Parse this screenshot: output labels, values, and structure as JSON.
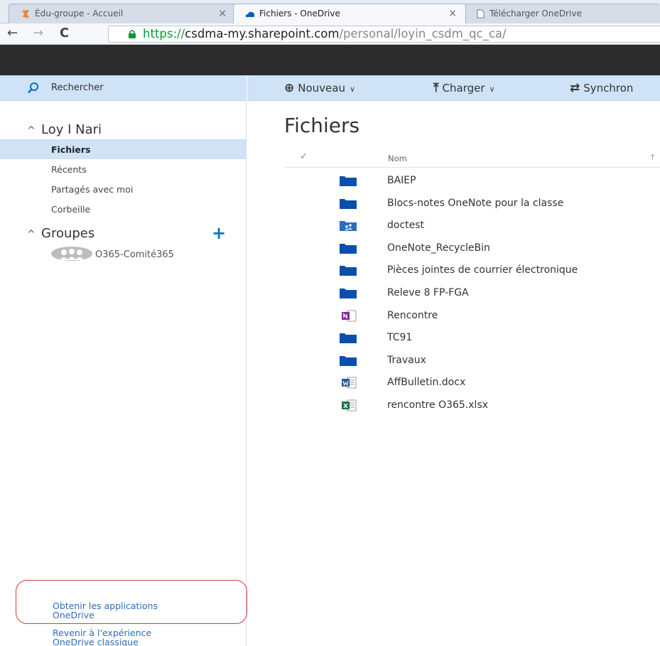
{
  "browser": {
    "tabs": [
      {
        "label": "Édu-groupe - Accueil",
        "close": "×"
      },
      {
        "label": "Fichiers - OneDrive",
        "close": "×"
      },
      {
        "label": "Télécharger OneDrive"
      }
    ],
    "url": {
      "scheme": "https://",
      "host": "csdma-my.sharepoint.com",
      "path": "/personal/loyin_csdm_qc_ca/"
    }
  },
  "leftnav": {
    "search_label": "Rechercher",
    "user_name": "Loy I Nari",
    "items": [
      {
        "label": "Fichiers"
      },
      {
        "label": "Récents"
      },
      {
        "label": "Partagés avec moi"
      },
      {
        "label": "Corbeille"
      }
    ],
    "groups_title": "Groupes",
    "groups_add": "+",
    "groups": [
      {
        "label": "O365-Comité365"
      }
    ],
    "get_apps_link": [
      "Obtenir les applications",
      "OneDrive"
    ],
    "classic_link": [
      "Revenir à l'expérience",
      "OneDrive classique"
    ]
  },
  "commandbar": {
    "new_label": "Nouveau",
    "upload_label": "Charger",
    "sync_label": "Synchron"
  },
  "main": {
    "title": "Fichiers",
    "column_name": "Nom",
    "files": [
      {
        "name": "BAIEP",
        "icon": "folder-icon"
      },
      {
        "name": "Blocs-notes OneNote pour la classe",
        "icon": "folder-icon"
      },
      {
        "name": "doctest",
        "icon": "shared-folder-icon"
      },
      {
        "name": "OneNote_RecycleBin",
        "icon": "folder-icon"
      },
      {
        "name": "Pièces jointes de courrier électronique",
        "icon": "folder-icon"
      },
      {
        "name": "Releve 8 FP-FGA",
        "icon": "folder-icon"
      },
      {
        "name": "Rencontre",
        "icon": "onenote-icon"
      },
      {
        "name": "TC91",
        "icon": "folder-icon"
      },
      {
        "name": "Travaux",
        "icon": "folder-icon"
      },
      {
        "name": "AffBulletin.docx",
        "icon": "word-icon"
      },
      {
        "name": "rencontre O365.xlsx",
        "icon": "excel-icon"
      }
    ]
  },
  "colors": {
    "accent": "#0072c6",
    "suitebar": "#2c2c2c",
    "selection": "#cfe2f6",
    "folder": "#0b4fae",
    "highlight_ring": "#d93a3a"
  }
}
